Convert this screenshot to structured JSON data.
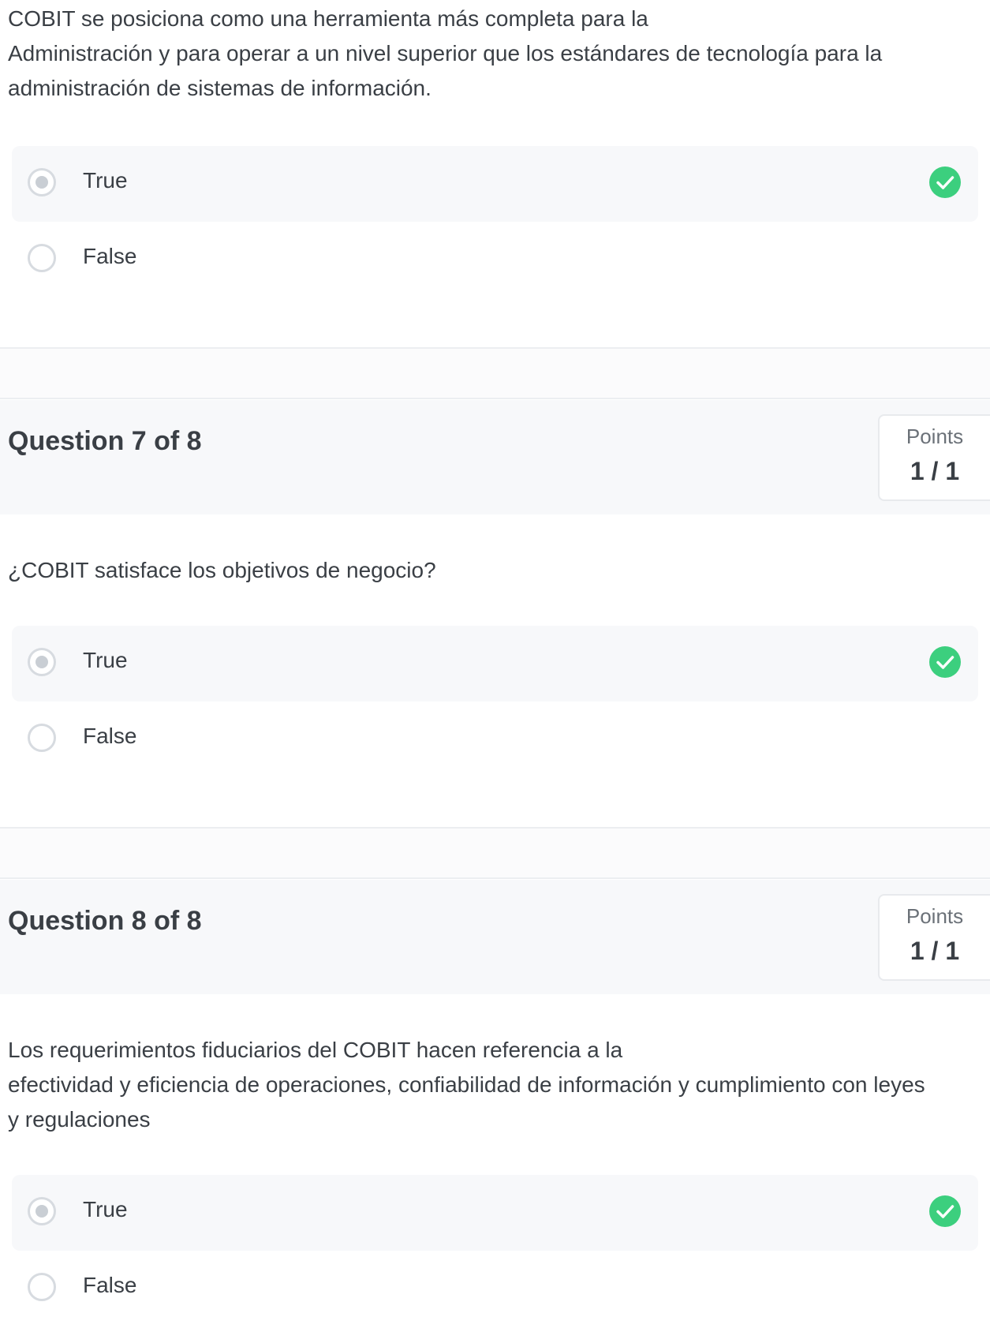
{
  "questions": [
    {
      "text": "COBIT se posiciona como una herramienta más completa para la\nAdministración y para operar a un nivel superior que los estándares de tecnología para la\nadministración de sistemas de información.",
      "options": [
        {
          "label": "True",
          "selected": true,
          "correct": true
        },
        {
          "label": "False",
          "selected": false,
          "correct": false
        }
      ]
    },
    {
      "title": "Question 7 of 8",
      "points_label": "Points",
      "points_value": "1 / 1",
      "text": "¿COBIT satisface los objetivos de negocio?",
      "options": [
        {
          "label": "True",
          "selected": true,
          "correct": true
        },
        {
          "label": "False",
          "selected": false,
          "correct": false
        }
      ]
    },
    {
      "title": "Question 8 of 8",
      "points_label": "Points",
      "points_value": "1 / 1",
      "text": "Los requerimientos fiduciarios del COBIT hacen referencia a la\nefectividad y eficiencia de operaciones, confiabilidad de información y cumplimiento con leyes\ny regulaciones",
      "options": [
        {
          "label": "True",
          "selected": true,
          "correct": true
        },
        {
          "label": "False",
          "selected": false,
          "correct": false
        }
      ]
    }
  ],
  "colors": {
    "correct_green": "#3ccf7e",
    "selected_bg": "#f7f8fa",
    "header_bg": "#f7f8fa"
  },
  "icons": {
    "correct": "check-circle-icon"
  }
}
